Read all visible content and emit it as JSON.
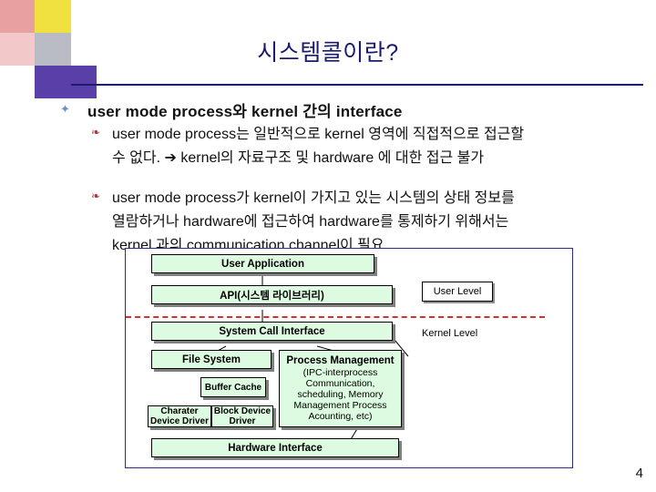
{
  "slide": {
    "title": "시스템콜이란?",
    "page_number": "4",
    "bullets": [
      {
        "level": 1,
        "marker": "diamond-bullet-icon",
        "text": "user mode process와 kernel 간의 interface"
      },
      {
        "level": 2,
        "marker": "dot-bullet-icon",
        "lines": [
          "user mode process는 일반적으로 kernel 영역에 직접적으로 접근할",
          "수 없다. ➔ kernel의 자료구조 및 hardware 에 대한 접근 불가"
        ]
      },
      {
        "level": 2,
        "marker": "dot-bullet-icon",
        "lines": [
          "user mode process가 kernel이 가지고 있는 시스템의 상태 정보를",
          "열람하거나 hardware에 접근하여 hardware를 통제하기 위해서는",
          "kernel 과의 communication channel이 필요."
        ]
      }
    ]
  },
  "diagram": {
    "type": "block-diagram",
    "levels": [
      {
        "id": "user-level",
        "label": "User Level"
      },
      {
        "id": "kernel-level",
        "label": "Kernel Level"
      }
    ],
    "boxes": [
      {
        "id": "user-application",
        "label": "User Application"
      },
      {
        "id": "api",
        "label": "API(시스템 라이브러리)"
      },
      {
        "id": "system-call-interface",
        "label": "System Call Interface"
      },
      {
        "id": "file-system",
        "label": "File System"
      },
      {
        "id": "process-management",
        "label": "Process Management",
        "sublabel": "(IPC-interprocess Communication, scheduling, Memory Management Process Acounting, etc)"
      },
      {
        "id": "buffer-cache",
        "label": "Buffer Cache"
      },
      {
        "id": "character-device-driver",
        "label": "Charater Device Driver"
      },
      {
        "id": "block-device-driver",
        "label": "Block Device Driver"
      },
      {
        "id": "hardware-interface",
        "label": "Hardware Interface"
      }
    ],
    "colors": {
      "box_fill": "#ddfbe0",
      "border": "#2b2b8c",
      "divider": "#d03030",
      "title": "#1a1a6e"
    }
  }
}
